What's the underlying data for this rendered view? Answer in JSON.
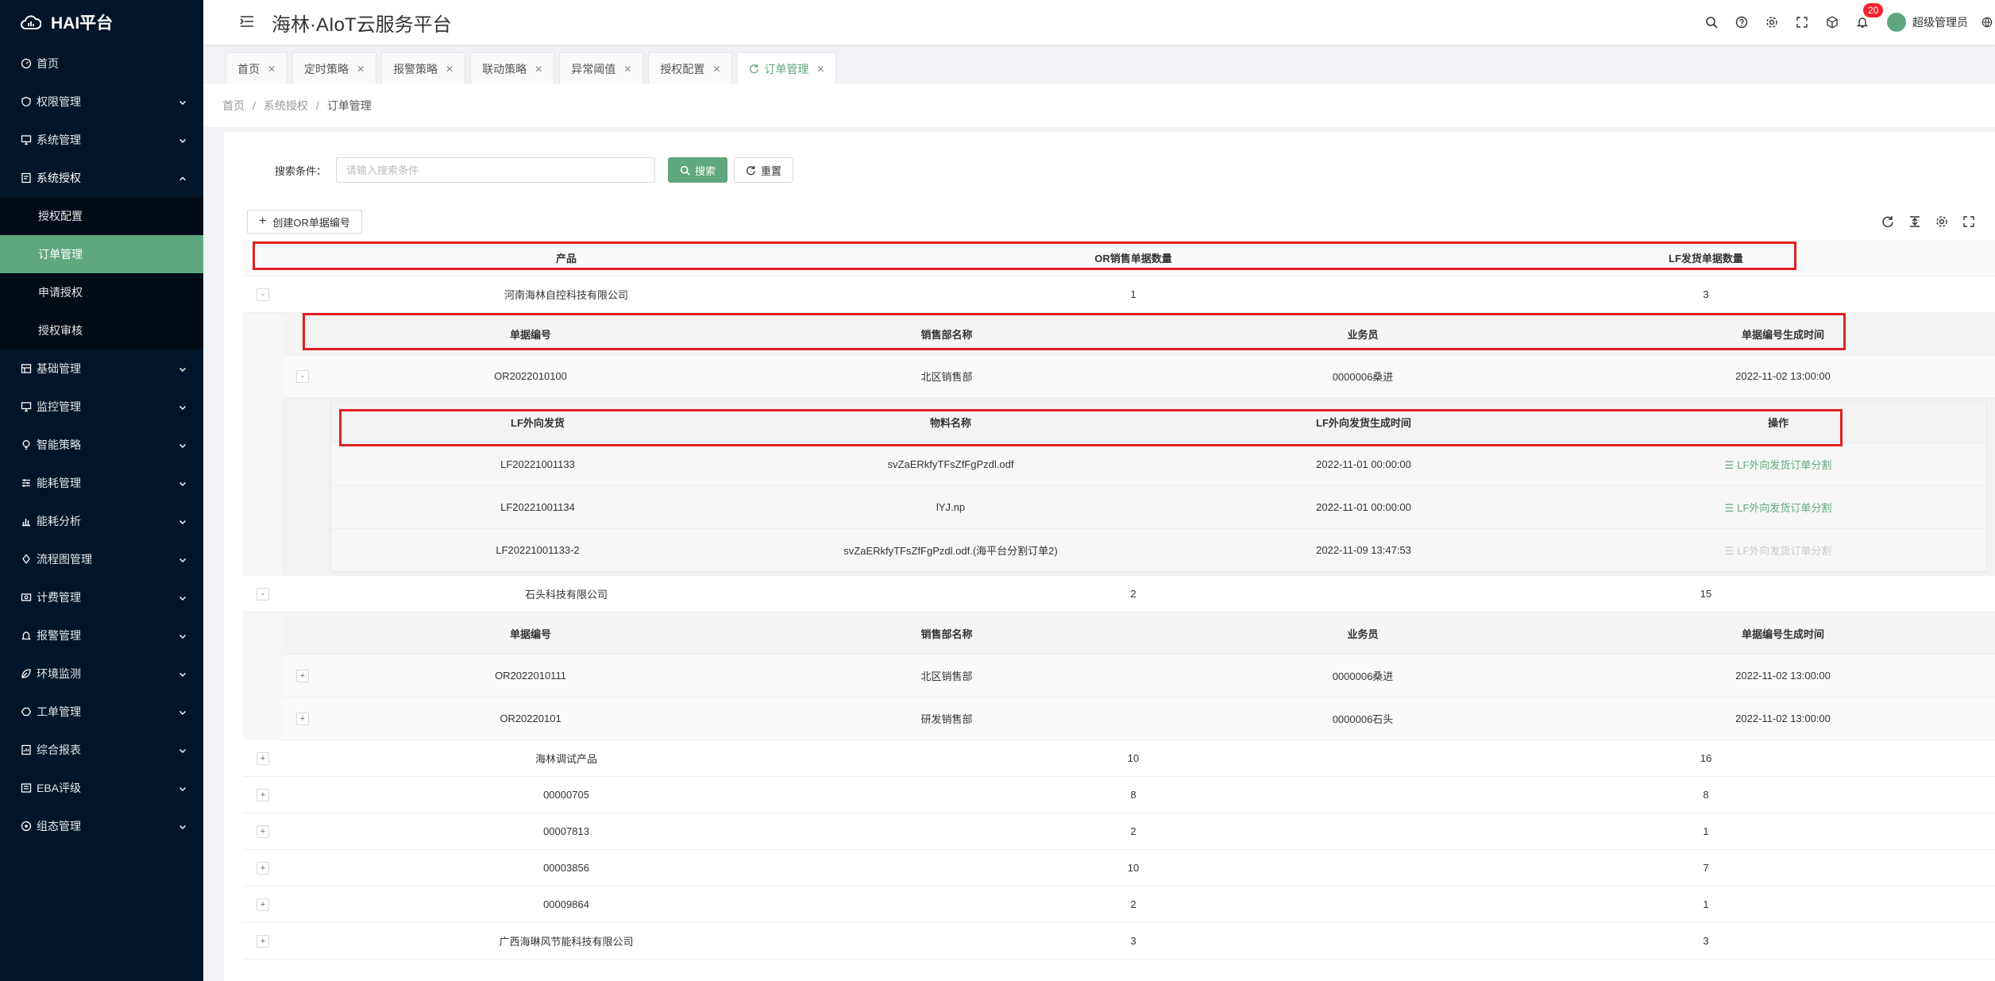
{
  "brand": {
    "logo_text": "HAI平台"
  },
  "sidebar": {
    "items": [
      {
        "label": "首页",
        "icon": "dashboard-icon",
        "arrow": false
      },
      {
        "label": "权限管理",
        "icon": "shield-icon",
        "arrow": true
      },
      {
        "label": "系统管理",
        "icon": "monitor-icon",
        "arrow": true
      },
      {
        "label": "系统授权",
        "icon": "certificate-icon",
        "arrow": true,
        "open": true,
        "children": [
          {
            "label": "授权配置"
          },
          {
            "label": "订单管理",
            "active": true
          },
          {
            "label": "申请授权"
          },
          {
            "label": "授权审核"
          }
        ]
      },
      {
        "label": "基础管理",
        "icon": "database-icon",
        "arrow": true
      },
      {
        "label": "监控管理",
        "icon": "monitor-icon",
        "arrow": true
      },
      {
        "label": "智能策略",
        "icon": "bulb-icon",
        "arrow": true
      },
      {
        "label": "能耗管理",
        "icon": "sliders-icon",
        "arrow": true
      },
      {
        "label": "能耗分析",
        "icon": "bar-chart-icon",
        "arrow": true
      },
      {
        "label": "流程图管理",
        "icon": "flow-icon",
        "arrow": true
      },
      {
        "label": "计费管理",
        "icon": "billing-icon",
        "arrow": true
      },
      {
        "label": "报警管理",
        "icon": "alarm-icon",
        "arrow": true
      },
      {
        "label": "环境监测",
        "icon": "leaf-icon",
        "arrow": true
      },
      {
        "label": "工单管理",
        "icon": "ticket-icon",
        "arrow": true
      },
      {
        "label": "综合报表",
        "icon": "report-icon",
        "arrow": true
      },
      {
        "label": "EBA评级",
        "icon": "rating-icon",
        "arrow": true
      },
      {
        "label": "组态管理",
        "icon": "config-icon",
        "arrow": true
      }
    ]
  },
  "header": {
    "title": "海林·AIoT云服务平台",
    "badge_count": "20",
    "user_name": "超级管理员"
  },
  "tabs": [
    {
      "label": "首页"
    },
    {
      "label": "定时策略"
    },
    {
      "label": "报警策略"
    },
    {
      "label": "联动策略"
    },
    {
      "label": "异常阈值"
    },
    {
      "label": "授权配置"
    },
    {
      "label": "订单管理",
      "active": true
    }
  ],
  "breadcrumb": [
    "首页",
    "系统授权",
    "订单管理"
  ],
  "search": {
    "label": "搜索条件：",
    "placeholder": "请输入搜索条件",
    "search_button": "搜索",
    "reset_button": "重置"
  },
  "create_button": "创建OR单据编号",
  "table": {
    "columns": [
      "产品",
      "OR销售单据数量",
      "LF发货单据数量"
    ],
    "sub_columns": [
      "单据编号",
      "销售部名称",
      "业务员",
      "单据编号生成时间"
    ],
    "sub2_columns": [
      "LF外向发货",
      "物料名称",
      "LF外向发货生成时间",
      "操作"
    ],
    "expanded_collapse_symbol": "-",
    "expand_symbol": "+",
    "rows": [
      {
        "product": "河南海林自控科技有限公司",
        "or_count": "1",
        "lf_count": "3",
        "expanded": true,
        "sub": [
          {
            "no": "OR2022010100",
            "dept": "北区销售部",
            "sales": "0000006桑进",
            "time": "2022-11-02 13:00:00",
            "expanded": true,
            "sub2": [
              {
                "lf": "LF20221001133",
                "material": "svZaERkfyTFsZfFgPzdl.odf",
                "time": "2022-11-01 00:00:00",
                "action": "LF外向发货订单分割",
                "disabled": false
              },
              {
                "lf": "LF20221001134",
                "material": "lYJ.np",
                "time": "2022-11-01 00:00:00",
                "action": "LF外向发货订单分割",
                "disabled": false
              },
              {
                "lf": "LF20221001133-2",
                "material": "svZaERkfyTFsZfFgPzdl.odf.(海平台分割订单2)",
                "time": "2022-11-09 13:47:53",
                "action": "LF外向发货订单分割",
                "disabled": true
              }
            ]
          }
        ]
      },
      {
        "product": "石头科技有限公司",
        "or_count": "2",
        "lf_count": "15",
        "expanded": true,
        "sub": [
          {
            "no": "OR2022010111",
            "dept": "北区销售部",
            "sales": "0000006桑进",
            "time": "2022-11-02 13:00:00",
            "expanded": false
          },
          {
            "no": "OR20220101",
            "dept": "研发销售部",
            "sales": "0000006石头",
            "time": "2022-11-02 13:00:00",
            "expanded": false
          }
        ]
      },
      {
        "product": "海林调试产品",
        "or_count": "10",
        "lf_count": "16"
      },
      {
        "product": "00000705",
        "or_count": "8",
        "lf_count": "8"
      },
      {
        "product": "00007813",
        "or_count": "2",
        "lf_count": "1"
      },
      {
        "product": "00003856",
        "or_count": "10",
        "lf_count": "7"
      },
      {
        "product": "00009864",
        "or_count": "2",
        "lf_count": "1"
      },
      {
        "product": "广西海琳风节能科技有限公司",
        "or_count": "3",
        "lf_count": "3"
      }
    ]
  },
  "colors": {
    "accent": "#5fa77f",
    "sidebar_bg": "#001529",
    "highlight_box": "#e02020"
  }
}
